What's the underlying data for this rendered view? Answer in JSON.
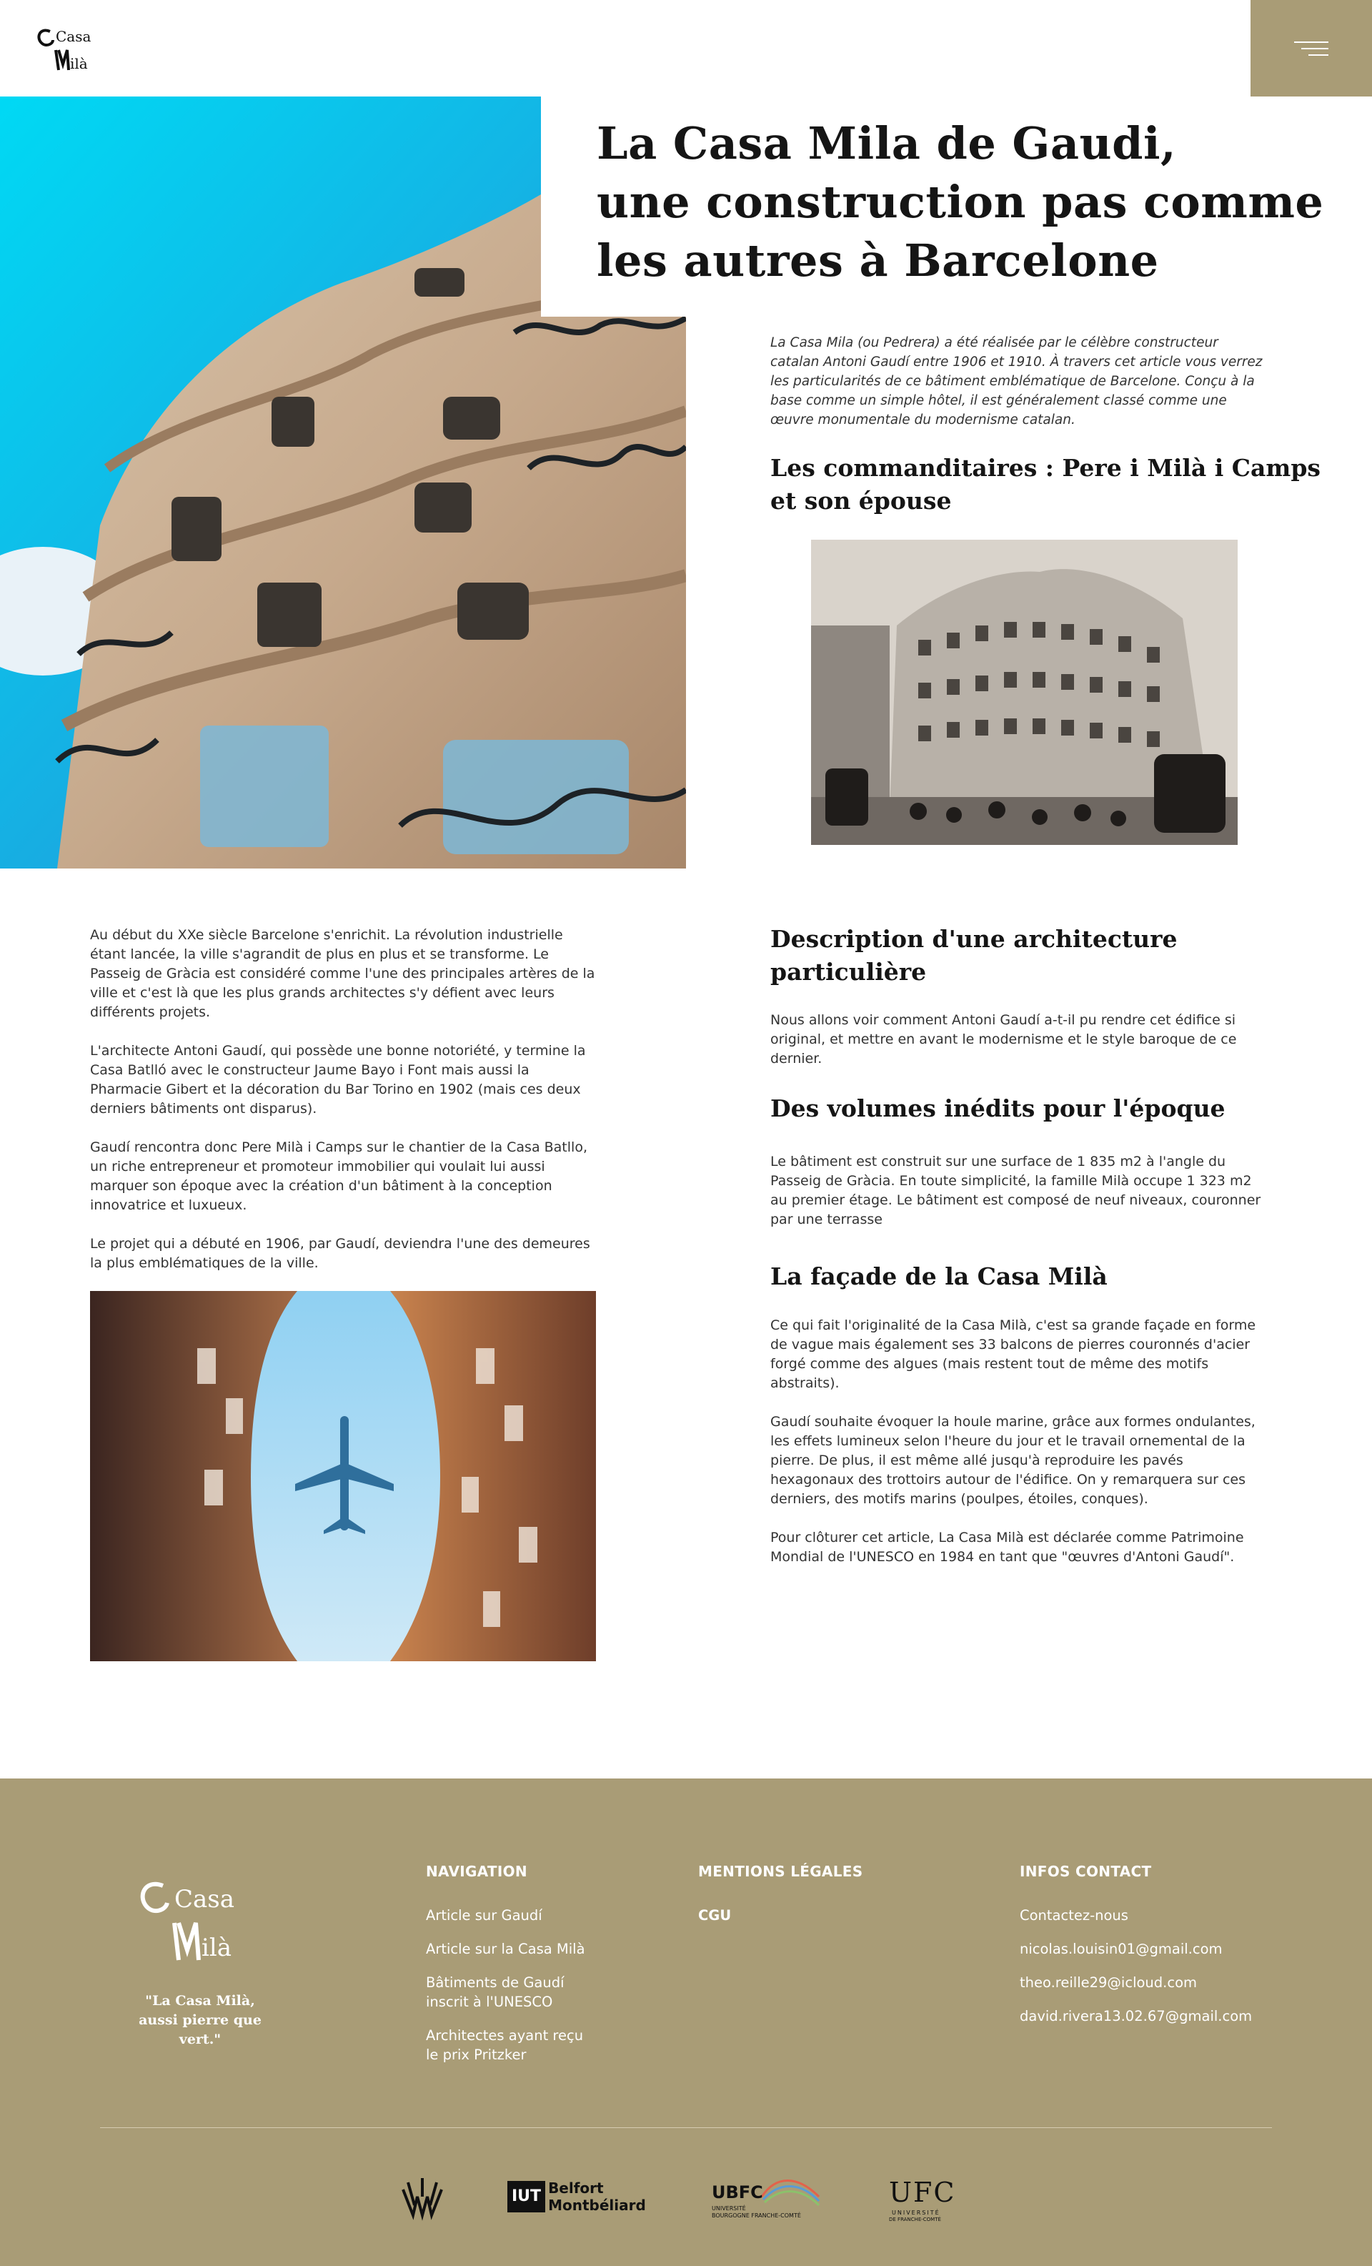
{
  "header": {
    "logo_line1": "Casa",
    "logo_line2": "Milà",
    "menu_icon": "hamburger-menu-icon"
  },
  "article": {
    "title_lines": [
      "La Casa Mila de Gaudi,",
      "une construction pas comme",
      "les autres à Barcelone"
    ],
    "intro": "La Casa Mila (ou Pedrera) a été réalisée par le célèbre constructeur catalan Antoni Gaudí entre 1906 et 1910. À travers cet article vous verrez les particularités de ce bâtiment emblématique de Barcelone. Conçu à la base comme un simple hôtel, il est généralement classé comme une œuvre monumentale du modernisme catalan.",
    "section1_title_lines": [
      "Les commanditaires : Pere i Milà i Camps",
      "et son épouse"
    ],
    "left_paragraphs": [
      "Au début du XXe siècle Barcelone s'enrichit. La révolution industrielle étant lancée, la ville s'agrandit de plus en plus et se transforme. Le Passeig de Gràcia est considéré comme l'une des principales artères de la ville et c'est là que les plus grands architectes s'y défient avec leurs différents projets.",
      "L'architecte Antoni Gaudí, qui possède une bonne notoriété, y termine la Casa Batlló avec le constructeur Jaume Bayo i Font mais aussi la Pharmacie Gibert et la décoration du Bar Torino en 1902 (mais ces deux derniers bâtiments ont disparus).",
      "Gaudí rencontra donc Pere Milà i Camps sur le chantier de la Casa Batllo, un riche entrepreneur et promoteur immobilier qui voulait lui aussi marquer son époque avec la création d'un bâtiment à la conception innovatrice et luxueux.",
      "Le projet qui a débuté en 1906, par Gaudí,  deviendra l'une des demeures la plus emblématiques de la ville."
    ],
    "section2_title_lines": [
      "Description d'une architecture",
      "particulière"
    ],
    "section2_text": "Nous allons voir comment Antoni Gaudí a-t-il pu rendre cet édifice si original, et mettre en avant le modernisme et le style baroque de ce dernier.",
    "section3_title": "Des volumes inédits pour l'époque",
    "section3_text": "Le bâtiment est construit sur une surface de 1 835 m2 à l'angle du Passeig de Gràcia. En toute simplicité, la famille Milà occupe 1 323 m2 au premier étage. Le bâtiment est composé de neuf niveaux, couronner par une terrasse",
    "section4_title": "La façade de la Casa Milà",
    "section4_paragraphs": [
      "Ce qui fait l'originalité de la Casa Milà, c'est sa grande façade en forme de vague mais également ses 33 balcons de pierres couronnés d'acier forgé comme des algues (mais restent tout de même des motifs abstraits).",
      "Gaudí souhaite évoquer la houle marine, grâce aux formes ondulantes, les effets lumineux selon l'heure du jour et le travail ornemental de la pierre. De plus, il est même allé jusqu'à reproduire les pavés hexagonaux des trottoirs autour de l'édifice. On y remarquera sur ces derniers, des motifs marins (poulpes, étoiles, conques).",
      "Pour clôturer cet article, La Casa Milà est déclarée comme Patrimoine Mondial de l'UNESCO en 1984 en tant que \"œuvres d'Antoni Gaudí\"."
    ]
  },
  "footer": {
    "logo_line1": "Casa",
    "logo_line2": "Milà",
    "quote": "\"La Casa Milà, aussi pierre que vert.\"",
    "nav_title": "NAVIGATION",
    "nav_links": [
      [
        "Article sur Gaudí"
      ],
      [
        "Article sur la Casa Milà"
      ],
      [
        "Bâtiments de Gaudí",
        "inscrit à l'UNESCO"
      ],
      [
        "Architectes ayant reçu",
        "le prix Pritzker"
      ]
    ],
    "legal_title": "MENTIONS LÉGALES",
    "legal_link": "CGU",
    "contact_title": "INFOS CONTACT",
    "contact_links": [
      "Contactez-nous",
      "nicolas.louisin01@gmail.com",
      "theo.reille29@icloud.com",
      "david.rivera13.02.67@gmail.com"
    ],
    "partners": {
      "iut_label": "IUT",
      "iut_name_line1": "Belfort",
      "iut_name_line2": "Montbéliard",
      "ubfc_label": "UBFC",
      "ubfc_sub1": "UNIVERSITÉ",
      "ubfc_sub2": "BOURGOGNE FRANCHE-COMTÉ",
      "ufc_label": "UFC",
      "ufc_sub1": "UNIVERSITÉ",
      "ufc_sub2": "DE FRANCHE-COMTÉ"
    }
  },
  "colors": {
    "accent": "#a99c76",
    "text": "#222222",
    "title": "#151515"
  }
}
